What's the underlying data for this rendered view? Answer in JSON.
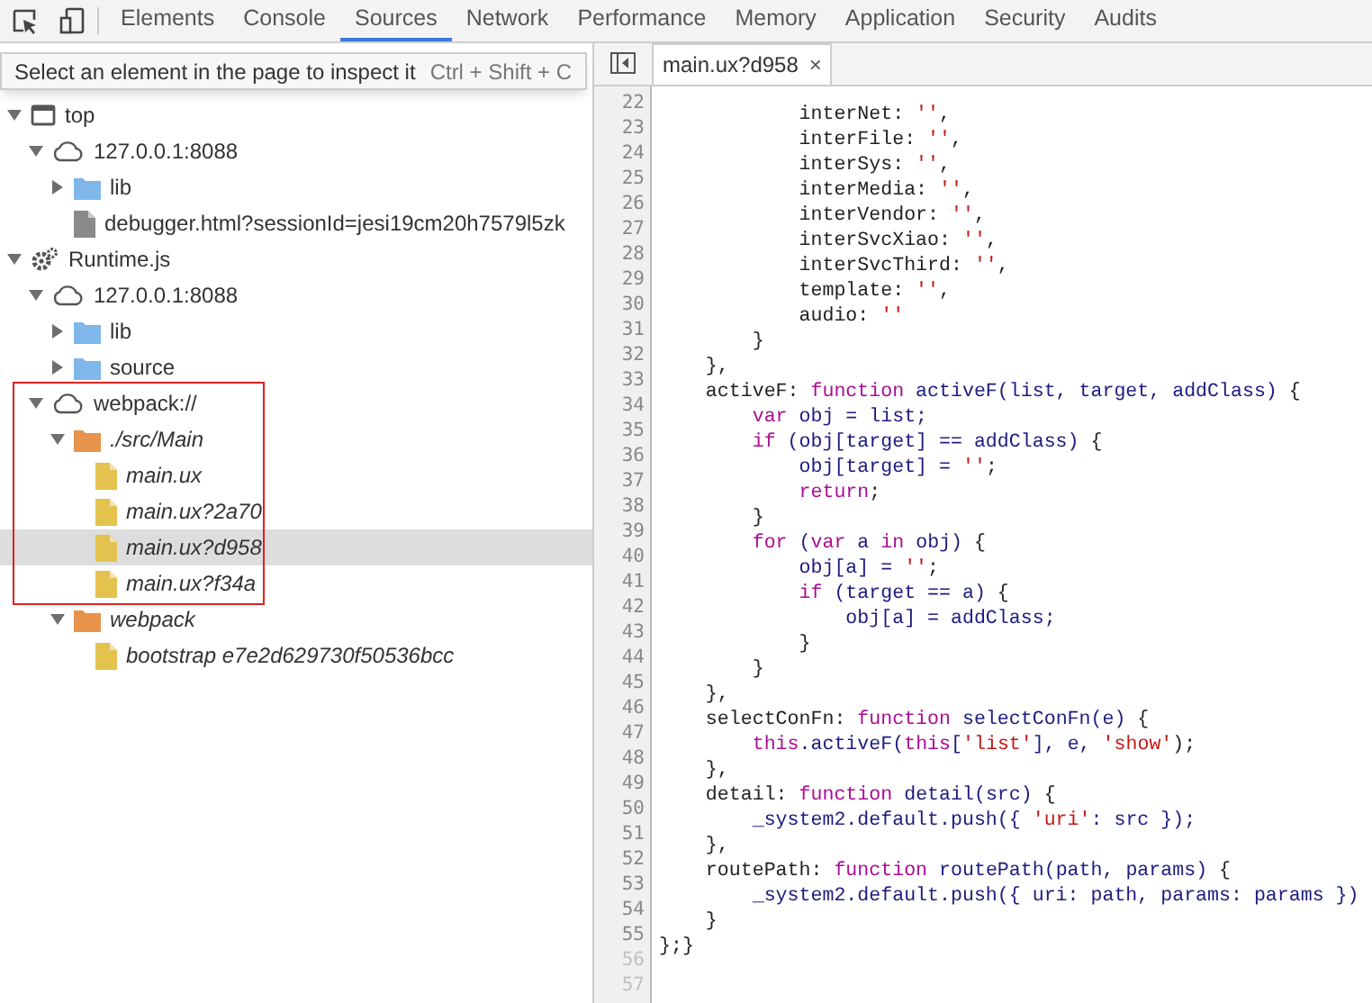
{
  "toolbar": {
    "tabs": [
      {
        "label": "Elements",
        "selected": false
      },
      {
        "label": "Console",
        "selected": false
      },
      {
        "label": "Sources",
        "selected": true
      },
      {
        "label": "Network",
        "selected": false
      },
      {
        "label": "Performance",
        "selected": false
      },
      {
        "label": "Memory",
        "selected": false
      },
      {
        "label": "Application",
        "selected": false
      },
      {
        "label": "Security",
        "selected": false
      },
      {
        "label": "Audits",
        "selected": false
      }
    ]
  },
  "tooltip": {
    "text": "Select an element in the page to inspect it",
    "shortcut": "Ctrl + Shift + C"
  },
  "navigator": {
    "tree": [
      {
        "label": "top",
        "kind": "frame",
        "expanded": true,
        "children": [
          {
            "label": "127.0.0.1:8088",
            "kind": "origin",
            "expanded": true,
            "children": [
              {
                "label": "lib",
                "kind": "folder",
                "expanded": false
              },
              {
                "label": "debugger.html?sessionId=jesi19cm20h7579l5zk",
                "kind": "file",
                "selected": false
              }
            ]
          }
        ]
      },
      {
        "label": "Runtime.js",
        "kind": "context",
        "expanded": true,
        "children": [
          {
            "label": "127.0.0.1:8088",
            "kind": "origin",
            "expanded": true,
            "children": [
              {
                "label": "lib",
                "kind": "folder",
                "expanded": false
              },
              {
                "label": "source",
                "kind": "folder",
                "expanded": false
              }
            ]
          },
          {
            "label": "webpack://",
            "kind": "origin",
            "expanded": true,
            "outlined": true,
            "children": [
              {
                "label": "./src/Main",
                "kind": "mapped-folder",
                "expanded": true,
                "children": [
                  {
                    "label": "main.ux",
                    "kind": "mapped-file",
                    "selected": false
                  },
                  {
                    "label": "main.ux?2a70",
                    "kind": "mapped-file",
                    "selected": false
                  },
                  {
                    "label": "main.ux?d958",
                    "kind": "mapped-file",
                    "selected": true
                  },
                  {
                    "label": "main.ux?f34a",
                    "kind": "mapped-file",
                    "selected": false
                  }
                ]
              },
              {
                "label": "webpack",
                "kind": "mapped-folder",
                "expanded": true,
                "children": [
                  {
                    "label": "bootstrap e7e2d629730f50536bcc",
                    "kind": "mapped-file",
                    "selected": false
                  }
                ]
              }
            ]
          }
        ]
      }
    ]
  },
  "editor": {
    "tabs": [
      {
        "label": "main.ux?d958",
        "close": "×"
      }
    ],
    "lines": [
      {
        "n": "22",
        "tokens": [
          {
            "kind": "plain",
            "text": "            interNet: "
          },
          {
            "kind": "str",
            "text": "''"
          },
          {
            "kind": "plain",
            "text": ","
          }
        ]
      },
      {
        "n": "23",
        "tokens": [
          {
            "kind": "plain",
            "text": "            interFile: "
          },
          {
            "kind": "str",
            "text": "''"
          },
          {
            "kind": "plain",
            "text": ","
          }
        ]
      },
      {
        "n": "24",
        "tokens": [
          {
            "kind": "plain",
            "text": "            interSys: "
          },
          {
            "kind": "str",
            "text": "''"
          },
          {
            "kind": "plain",
            "text": ","
          }
        ]
      },
      {
        "n": "25",
        "tokens": [
          {
            "kind": "plain",
            "text": "            interMedia: "
          },
          {
            "kind": "str",
            "text": "''"
          },
          {
            "kind": "plain",
            "text": ","
          }
        ]
      },
      {
        "n": "26",
        "tokens": [
          {
            "kind": "plain",
            "text": "            interVendor: "
          },
          {
            "kind": "str",
            "text": "''"
          },
          {
            "kind": "plain",
            "text": ","
          }
        ]
      },
      {
        "n": "27",
        "tokens": [
          {
            "kind": "plain",
            "text": "            interSvcXiao: "
          },
          {
            "kind": "str",
            "text": "''"
          },
          {
            "kind": "plain",
            "text": ","
          }
        ]
      },
      {
        "n": "28",
        "tokens": [
          {
            "kind": "plain",
            "text": "            interSvcThird: "
          },
          {
            "kind": "str",
            "text": "''"
          },
          {
            "kind": "plain",
            "text": ","
          }
        ]
      },
      {
        "n": "29",
        "tokens": [
          {
            "kind": "plain",
            "text": "            template: "
          },
          {
            "kind": "str",
            "text": "''"
          },
          {
            "kind": "plain",
            "text": ","
          }
        ]
      },
      {
        "n": "30",
        "tokens": [
          {
            "kind": "plain",
            "text": "            audio: "
          },
          {
            "kind": "str",
            "text": "''"
          }
        ]
      },
      {
        "n": "31",
        "tokens": [
          {
            "kind": "plain",
            "text": "        }"
          }
        ]
      },
      {
        "n": "32",
        "tokens": [
          {
            "kind": "plain",
            "text": "    },"
          }
        ]
      },
      {
        "n": "33",
        "tokens": [
          {
            "kind": "plain",
            "text": "    activeF: "
          },
          {
            "kind": "kw",
            "text": "function"
          },
          {
            "kind": "var",
            "text": " activeF(list, target, addClass) "
          },
          {
            "kind": "plain",
            "text": "{"
          }
        ]
      },
      {
        "n": "34",
        "tokens": [
          {
            "kind": "kw",
            "text": "        var"
          },
          {
            "kind": "var",
            "text": " obj = list;"
          }
        ]
      },
      {
        "n": "35",
        "tokens": [
          {
            "kind": "kw",
            "text": "        if"
          },
          {
            "kind": "var",
            "text": " (obj[target] == addClass) "
          },
          {
            "kind": "plain",
            "text": "{"
          }
        ]
      },
      {
        "n": "36",
        "tokens": [
          {
            "kind": "var",
            "text": "            obj[target] = "
          },
          {
            "kind": "str",
            "text": "''"
          },
          {
            "kind": "plain",
            "text": ";"
          }
        ]
      },
      {
        "n": "37",
        "tokens": [
          {
            "kind": "kw",
            "text": "            return"
          },
          {
            "kind": "plain",
            "text": ";"
          }
        ]
      },
      {
        "n": "38",
        "tokens": [
          {
            "kind": "plain",
            "text": "        }"
          }
        ]
      },
      {
        "n": "39",
        "tokens": [
          {
            "kind": "kw",
            "text": "        for"
          },
          {
            "kind": "var",
            "text": " ("
          },
          {
            "kind": "kw",
            "text": "var"
          },
          {
            "kind": "var",
            "text": " a "
          },
          {
            "kind": "kw",
            "text": "in"
          },
          {
            "kind": "var",
            "text": " obj) "
          },
          {
            "kind": "plain",
            "text": "{"
          }
        ]
      },
      {
        "n": "40",
        "tokens": [
          {
            "kind": "var",
            "text": "            obj[a] = "
          },
          {
            "kind": "str",
            "text": "''"
          },
          {
            "kind": "plain",
            "text": ";"
          }
        ]
      },
      {
        "n": "41",
        "tokens": [
          {
            "kind": "kw",
            "text": "            if"
          },
          {
            "kind": "var",
            "text": " (target == a) "
          },
          {
            "kind": "plain",
            "text": "{"
          }
        ]
      },
      {
        "n": "42",
        "tokens": [
          {
            "kind": "var",
            "text": "                obj[a] = addClass;"
          }
        ]
      },
      {
        "n": "43",
        "tokens": [
          {
            "kind": "plain",
            "text": "            }"
          }
        ]
      },
      {
        "n": "44",
        "tokens": [
          {
            "kind": "plain",
            "text": "        }"
          }
        ]
      },
      {
        "n": "45",
        "tokens": [
          {
            "kind": "plain",
            "text": "    },"
          }
        ]
      },
      {
        "n": "46",
        "tokens": [
          {
            "kind": "plain",
            "text": "    selectConFn: "
          },
          {
            "kind": "kw",
            "text": "function"
          },
          {
            "kind": "var",
            "text": " selectConFn(e) "
          },
          {
            "kind": "plain",
            "text": "{"
          }
        ]
      },
      {
        "n": "47",
        "tokens": [
          {
            "kind": "kw",
            "text": "        this"
          },
          {
            "kind": "var",
            "text": ".activeF("
          },
          {
            "kind": "kw",
            "text": "this"
          },
          {
            "kind": "var",
            "text": "["
          },
          {
            "kind": "str",
            "text": "'list'"
          },
          {
            "kind": "var",
            "text": "], e, "
          },
          {
            "kind": "str",
            "text": "'show'"
          },
          {
            "kind": "plain",
            "text": ");"
          }
        ]
      },
      {
        "n": "48",
        "tokens": [
          {
            "kind": "plain",
            "text": "    },"
          }
        ]
      },
      {
        "n": "49",
        "tokens": [
          {
            "kind": "plain",
            "text": "    detail: "
          },
          {
            "kind": "kw",
            "text": "function"
          },
          {
            "kind": "var",
            "text": " detail(src) "
          },
          {
            "kind": "plain",
            "text": "{"
          }
        ]
      },
      {
        "n": "50",
        "tokens": [
          {
            "kind": "var",
            "text": "        _system2.default.push({ "
          },
          {
            "kind": "str",
            "text": "'uri'"
          },
          {
            "kind": "var",
            "text": ": src });"
          }
        ]
      },
      {
        "n": "51",
        "tokens": [
          {
            "kind": "plain",
            "text": "    },"
          }
        ]
      },
      {
        "n": "52",
        "tokens": [
          {
            "kind": "plain",
            "text": "    routePath: "
          },
          {
            "kind": "kw",
            "text": "function"
          },
          {
            "kind": "var",
            "text": " routePath(path, params) "
          },
          {
            "kind": "plain",
            "text": "{"
          }
        ]
      },
      {
        "n": "53",
        "tokens": [
          {
            "kind": "var",
            "text": "        _system2.default.push({ uri: path, params: params })"
          }
        ]
      },
      {
        "n": "54",
        "tokens": [
          {
            "kind": "plain",
            "text": "    }"
          }
        ]
      },
      {
        "n": "55",
        "tokens": [
          {
            "kind": "plain",
            "text": "};}"
          }
        ]
      },
      {
        "n": "56"
      },
      {
        "n": "57"
      }
    ]
  }
}
